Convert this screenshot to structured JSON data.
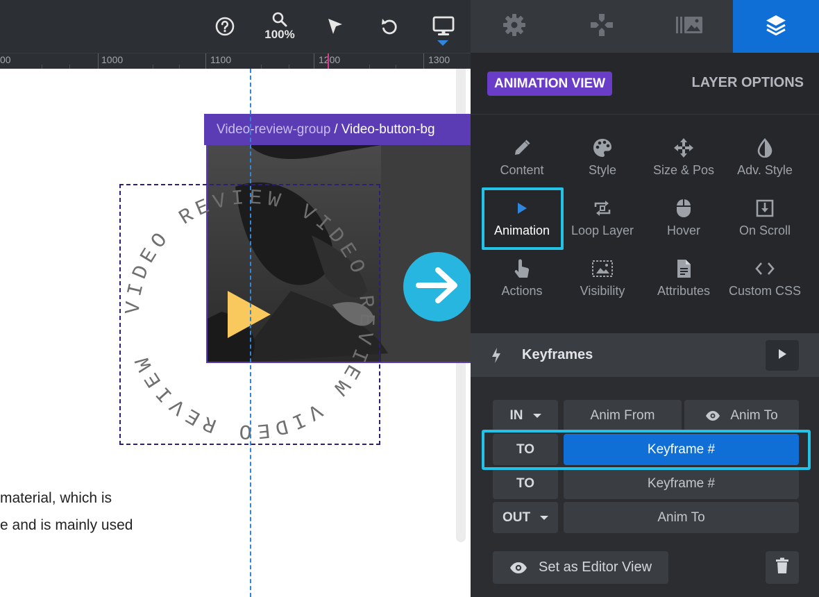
{
  "toolbar": {
    "zoom_label": "100%",
    "icons": [
      "help-icon",
      "zoom-icon",
      "select-cursor-icon",
      "undo-icon",
      "desktop-icon"
    ]
  },
  "ruler": {
    "labels": [
      "00",
      "1000",
      "1100",
      "1200",
      "1300"
    ]
  },
  "breadcrumb": {
    "parent": "Video-review-group",
    "separator": "/",
    "current": "Video-button-bg"
  },
  "ring": {
    "text": "VIDEO REVIEW VIDEO REVIEW VIDEO REVIEW"
  },
  "canvas_text": {
    "line1": "material, which is",
    "line2": "e and is mainly used"
  },
  "panel_tabs": [
    "settings-icon",
    "gamepad-icon",
    "media-library-icon",
    "layers-icon"
  ],
  "view": {
    "animation_view": "ANIMATION VIEW",
    "layer_options": "LAYER OPTIONS"
  },
  "menu": {
    "items": [
      {
        "label": "Content",
        "icon": "pencil-icon"
      },
      {
        "label": "Style",
        "icon": "palette-icon"
      },
      {
        "label": "Size & Pos",
        "icon": "move-arrows-icon"
      },
      {
        "label": "Adv. Style",
        "icon": "contrast-icon"
      },
      {
        "label": "Animation",
        "icon": "play-icon"
      },
      {
        "label": "Loop Layer",
        "icon": "loop-icon"
      },
      {
        "label": "Hover",
        "icon": "mouse-icon"
      },
      {
        "label": "On Scroll",
        "icon": "scroll-download-icon"
      },
      {
        "label": "Actions",
        "icon": "pointer-hand-icon"
      },
      {
        "label": "Visibility",
        "icon": "visibility-icon"
      },
      {
        "label": "Attributes",
        "icon": "document-icon"
      },
      {
        "label": "Custom CSS",
        "icon": "code-icon"
      }
    ]
  },
  "keyframes": {
    "title": "Keyframes",
    "rows": [
      {
        "label": "IN",
        "cells": [
          "Anim From",
          "Anim To"
        ]
      },
      {
        "label": "TO",
        "cells": [
          "Keyframe #"
        ]
      },
      {
        "label": "TO",
        "cells": [
          "Keyframe #"
        ]
      },
      {
        "label": "OUT",
        "cells": [
          "Anim To"
        ]
      }
    ]
  },
  "footer": {
    "set_editor_view": "Set as Editor View"
  },
  "colors": {
    "accent_blue": "#0f6fd6",
    "highlight_cyan": "#22c3e6",
    "purple": "#6a3dc9",
    "play_yellow": "#f9c95d"
  }
}
